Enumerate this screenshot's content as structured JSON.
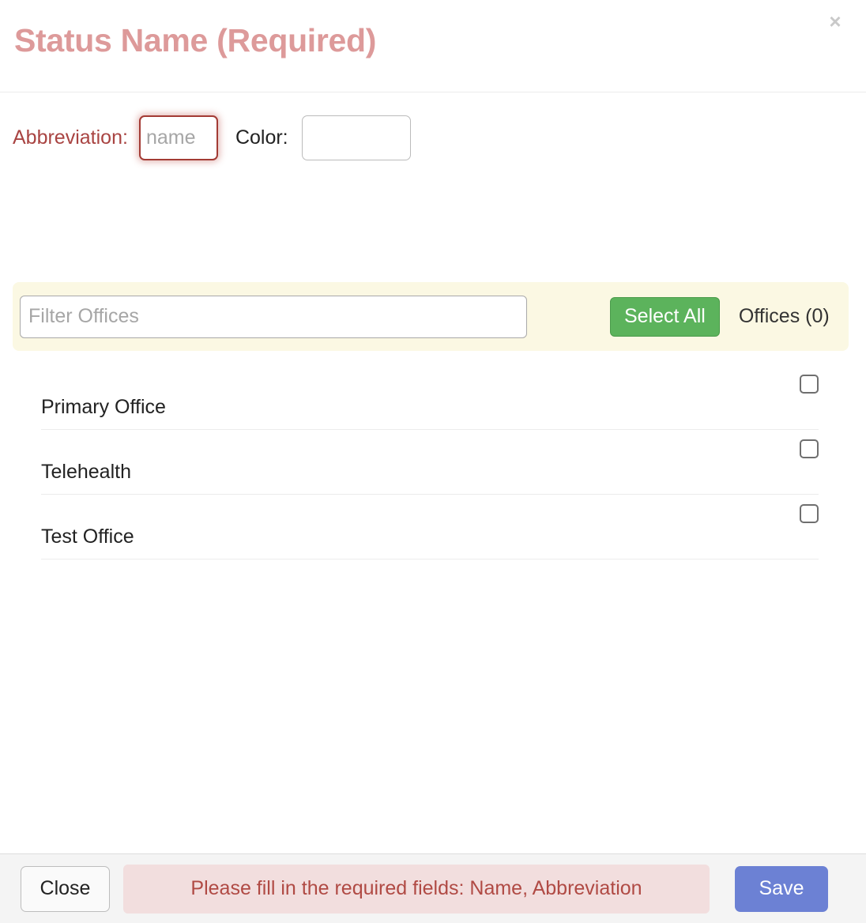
{
  "header": {
    "title_placeholder": "Status Name (Required)",
    "title_value": "",
    "close_icon": "×"
  },
  "form": {
    "abbreviation_label": "Abbreviation:",
    "abbreviation_placeholder": "name",
    "abbreviation_value": "",
    "color_label": "Color:",
    "color_placeholder": "",
    "color_value": ""
  },
  "filter_bar": {
    "filter_placeholder": "Filter Offices",
    "filter_value": "",
    "select_all_label": "Select All",
    "offices_count_label": "Offices (0)"
  },
  "offices": [
    {
      "name": "Primary Office",
      "checked": false
    },
    {
      "name": "Telehealth",
      "checked": false
    },
    {
      "name": "Test Office",
      "checked": false
    }
  ],
  "footer": {
    "close_label": "Close",
    "validation_message": "Please fill in the required fields: Name, Abbreviation",
    "save_label": "Save"
  },
  "colors": {
    "title_pink": "#dd9a9a",
    "required_red": "#a94442",
    "alert_bg": "#f2dede",
    "alert_text": "#b04a44",
    "select_all_green": "#5cb35c",
    "save_blue": "#6c81d4",
    "filter_panel_cream": "#fbf8e3",
    "footer_gray": "#f4f4f4"
  }
}
